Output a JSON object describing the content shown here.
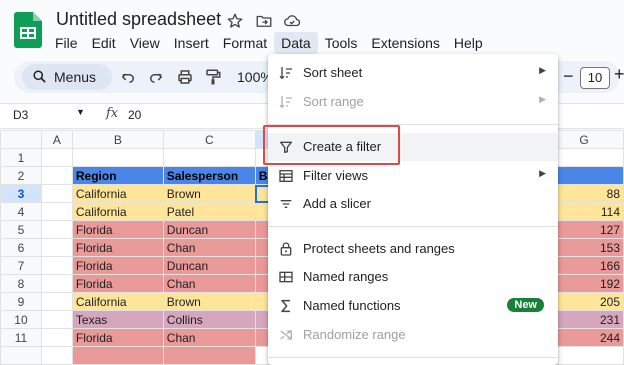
{
  "app": {
    "title": "Untitled spreadsheet",
    "menu": [
      "File",
      "Edit",
      "View",
      "Insert",
      "Format",
      "Data",
      "Tools",
      "Extensions",
      "Help"
    ]
  },
  "toolbar": {
    "menus_label": "Menus",
    "zoom": "100%",
    "font_size": "10",
    "minus": "−",
    "plus": "+"
  },
  "formula_bar": {
    "cell_ref": "D3",
    "fx": "fx",
    "value": "20"
  },
  "grid": {
    "columns": [
      "A",
      "B",
      "C",
      "",
      "",
      "",
      "G"
    ],
    "rows": [
      {
        "n": "1",
        "region": "",
        "salesperson": "",
        "g": ""
      },
      {
        "n": "2",
        "region": "Region",
        "salesperson": "Salesperson",
        "d": "Ba",
        "g": ""
      },
      {
        "n": "3",
        "region": "California",
        "salesperson": "Brown",
        "g": "88"
      },
      {
        "n": "4",
        "region": "California",
        "salesperson": "Patel",
        "g": "114"
      },
      {
        "n": "5",
        "region": "Florida",
        "salesperson": "Duncan",
        "g": "127"
      },
      {
        "n": "6",
        "region": "Florida",
        "salesperson": "Chan",
        "g": "153"
      },
      {
        "n": "7",
        "region": "Florida",
        "salesperson": "Duncan",
        "g": "166"
      },
      {
        "n": "8",
        "region": "Florida",
        "salesperson": "Chan",
        "g": "192"
      },
      {
        "n": "9",
        "region": "California",
        "salesperson": "Brown",
        "g": "205"
      },
      {
        "n": "10",
        "region": "Texas",
        "salesperson": "Collins",
        "g": "231"
      },
      {
        "n": "11",
        "region": "Florida",
        "salesperson": "Chan",
        "g": "244"
      }
    ]
  },
  "data_menu": {
    "sort_sheet": "Sort sheet",
    "sort_range": "Sort range",
    "create_filter": "Create a filter",
    "filter_views": "Filter views",
    "add_slicer": "Add a slicer",
    "protect": "Protect sheets and ranges",
    "named_ranges": "Named ranges",
    "named_functions": "Named functions",
    "new_badge": "New",
    "randomize": "Randomize range"
  },
  "colors": {
    "header_blue": "#4a86e8",
    "california": "#ffe599",
    "florida": "#ea9999",
    "texas": "#d5a6bd",
    "highlight_red": "#e04848",
    "new_green": "#188038"
  }
}
